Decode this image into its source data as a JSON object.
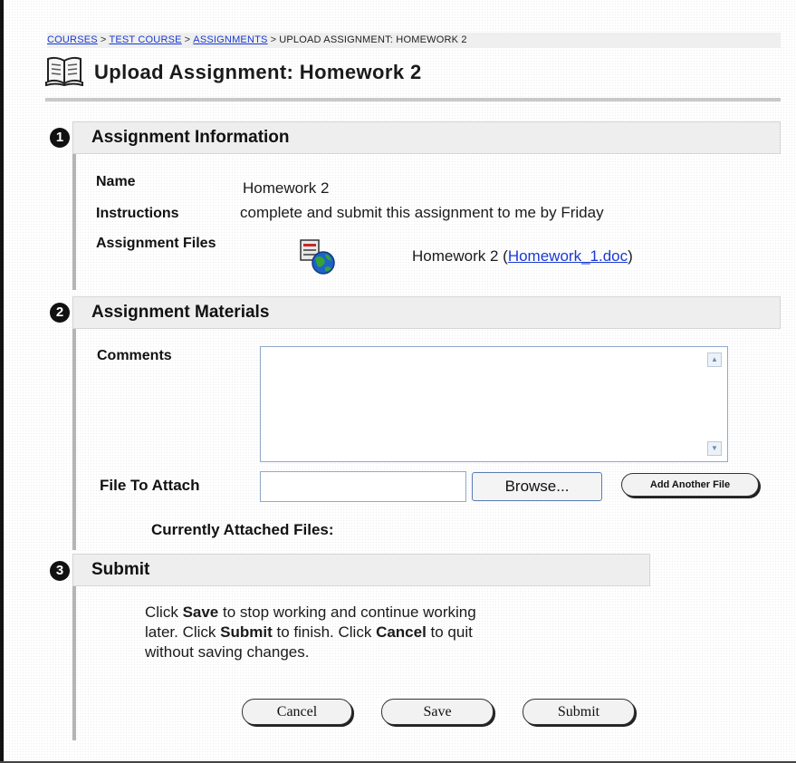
{
  "breadcrumb": {
    "items": [
      {
        "label": "COURSES",
        "link": true
      },
      {
        "label": "TEST COURSE",
        "link": true
      },
      {
        "label": "ASSIGNMENTS",
        "link": true
      },
      {
        "label": "UPLOAD ASSIGNMENT: HOMEWORK 2",
        "link": false
      }
    ],
    "separator": ">"
  },
  "page": {
    "title": "Upload Assignment: Homework 2",
    "icon": "open-book-icon"
  },
  "section1": {
    "number": "1",
    "title": "Assignment Information",
    "name_label": "Name",
    "name_value": "Homework 2",
    "instructions_label": "Instructions",
    "instructions_value": "complete and submit this assignment to me by Friday",
    "files_label": "Assignment Files",
    "files_icon": "document-globe-icon",
    "file_title": "Homework 2",
    "file_open": "(",
    "file_link": "Homework_1.doc",
    "file_close": ")"
  },
  "section2": {
    "number": "2",
    "title": "Assignment Materials",
    "comments_label": "Comments",
    "comments_value": "",
    "attach_label": "File To Attach",
    "attach_value": "",
    "browse_label": "Browse...",
    "add_file_label": "Add Another File",
    "attached_label": "Currently Attached Files:"
  },
  "section3": {
    "number": "3",
    "title": "Submit",
    "line1_a": "Click ",
    "line1_b": "Save",
    "line1_c": " to stop working and continue working",
    "line2_a": "later. Click ",
    "line2_b": "Submit",
    "line2_c": " to finish. Click ",
    "line2_d": "Cancel",
    "line2_e": " to quit",
    "line3": "without saving changes."
  },
  "buttons": {
    "cancel": "Cancel",
    "save": "Save",
    "submit": "Submit"
  },
  "colors": {
    "link": "#1a3ad2",
    "section_bg": "#eeeeee",
    "rule": "#c9c9c9"
  }
}
